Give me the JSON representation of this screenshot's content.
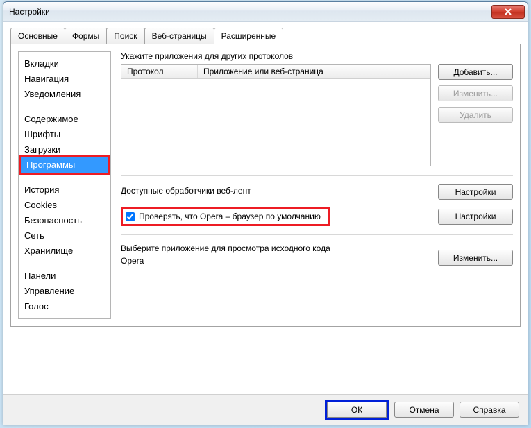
{
  "window": {
    "title": "Настройки"
  },
  "tabs": [
    {
      "label": "Основные",
      "active": false
    },
    {
      "label": "Формы",
      "active": false
    },
    {
      "label": "Поиск",
      "active": false
    },
    {
      "label": "Веб-страницы",
      "active": false
    },
    {
      "label": "Расширенные",
      "active": true
    }
  ],
  "sidebar": {
    "groups": [
      [
        "Вкладки",
        "Навигация",
        "Уведомления"
      ],
      [
        "Содержимое",
        "Шрифты",
        "Загрузки",
        "Программы"
      ],
      [
        "История",
        "Cookies",
        "Безопасность",
        "Сеть",
        "Хранилище"
      ],
      [
        "Панели",
        "Управление",
        "Голос"
      ]
    ],
    "selected": "Программы"
  },
  "content": {
    "protocols_label": "Укажите приложения для других протоколов",
    "table": {
      "col1": "Протокол",
      "col2": "Приложение или веб-страница"
    },
    "buttons": {
      "add": "Добавить...",
      "edit": "Изменить...",
      "del": "Удалить"
    },
    "feeds_label": "Доступные обработчики веб-лент",
    "settings": "Настройки",
    "default_check": "Проверять, что Opera – браузер по умолчанию",
    "default_checked": true,
    "source_label": "Выберите приложение для просмотра исходного кода",
    "source_app": "Opera",
    "source_edit": "Изменить..."
  },
  "footer": {
    "ok": "ОК",
    "cancel": "Отмена",
    "help": "Справка"
  }
}
